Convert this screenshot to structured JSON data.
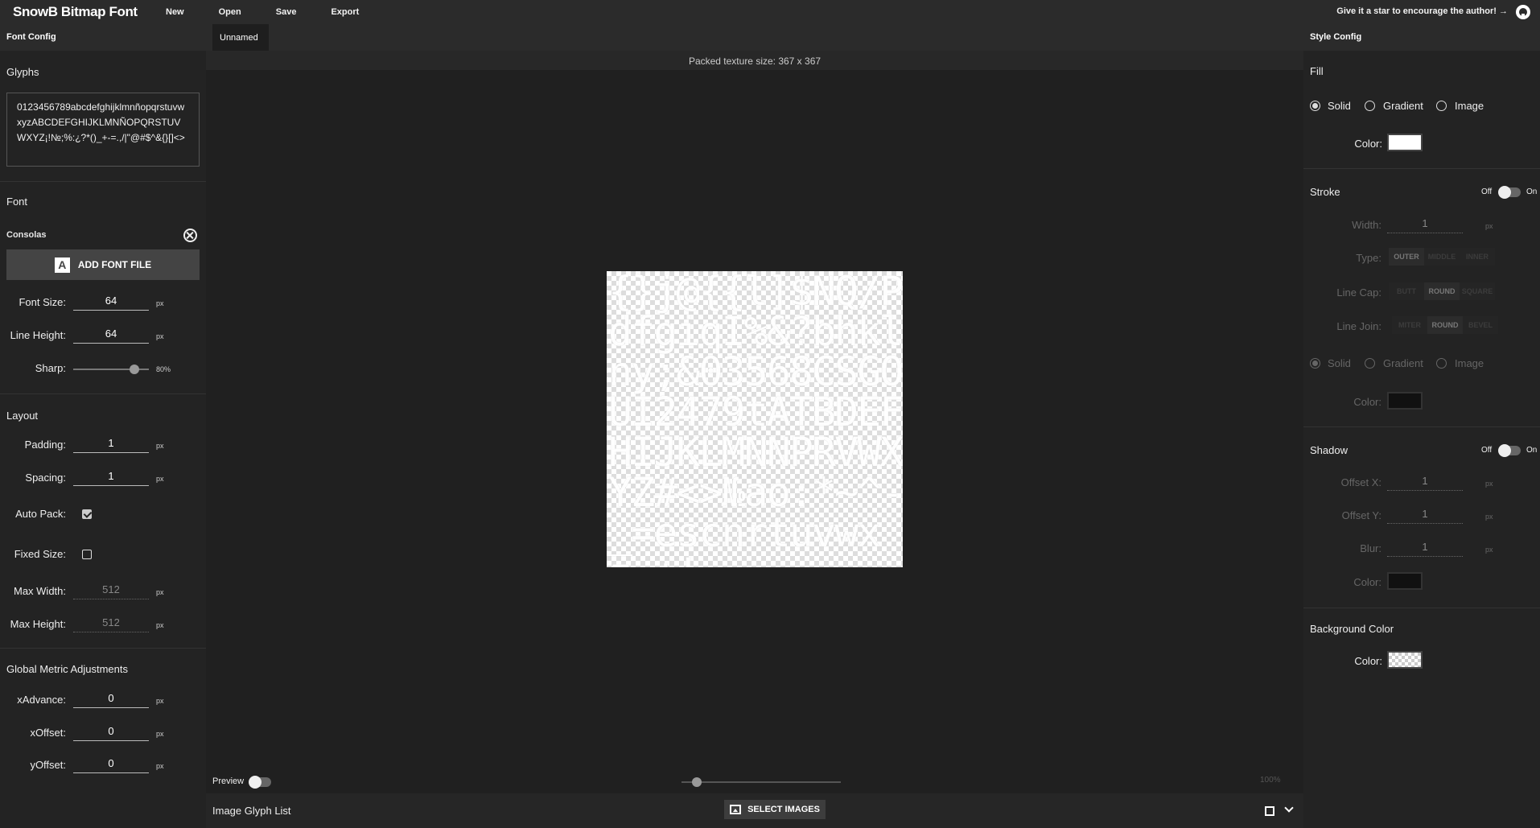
{
  "app": {
    "title": "SnowB Bitmap Font",
    "menu": [
      "New",
      "Open",
      "Save",
      "Export"
    ],
    "star_message": "Give it a star to encourage the author! →"
  },
  "left_panel": {
    "header": "Font Config",
    "glyphs": {
      "title": "Glyphs",
      "text": "0123456789abcdefghijklmnñopqrstuvwxyzABCDEFGHIJKLMNÑOPQRSTUVWXYZ¡!№;%:¿?*()_+-=.,/|\"@#$^&{}[]<>"
    },
    "font": {
      "title": "Font",
      "font_name": "Consolas",
      "add_button": "ADD FONT FILE",
      "font_size": {
        "label": "Font Size:",
        "value": "64",
        "unit": "px"
      },
      "line_height": {
        "label": "Line Height:",
        "value": "64",
        "unit": "px"
      },
      "sharp": {
        "label": "Sharp:",
        "value": "80%",
        "level": 0.8
      }
    },
    "layout": {
      "title": "Layout",
      "padding": {
        "label": "Padding:",
        "value": "1",
        "unit": "px"
      },
      "spacing": {
        "label": "Spacing:",
        "value": "1",
        "unit": "px"
      },
      "auto_pack": {
        "label": "Auto Pack:",
        "checked": true
      },
      "fixed_size": {
        "label": "Fixed Size:",
        "checked": false
      },
      "max_width": {
        "label": "Max Width:",
        "value": "512",
        "unit": "px"
      },
      "max_height": {
        "label": "Max Height:",
        "value": "512",
        "unit": "px"
      }
    },
    "metrics": {
      "title": "Global Metric Adjustments",
      "x_advance": {
        "label": "xAdvance:",
        "value": "0",
        "unit": "px"
      },
      "x_offset": {
        "label": "xOffset:",
        "value": "0",
        "unit": "px"
      },
      "y_offset": {
        "label": "yOffset:",
        "value": "0",
        "unit": "px"
      }
    }
  },
  "center": {
    "tab": "Unnamed",
    "packed_info": "Packed texture size: 367 x 367",
    "texture_glyphs": "{}j@{{l]$NQ/PdfgiqI%&?bhklny;&03568CSGOUI2479tATBDEFHIJKLMNNPRVWXYZ#<>№ao:*~^-_=escnrtuvwxz.+!",
    "preview_label": "Preview",
    "preview_on": false,
    "zoom": "100%",
    "image_glyph_list": "Image Glyph List",
    "select_images": "SELECT IMAGES"
  },
  "right_panel": {
    "header": "Style Config",
    "fill": {
      "title": "Fill",
      "options": [
        "Solid",
        "Gradient",
        "Image"
      ],
      "selected": "Solid",
      "color_label": "Color:",
      "color": "#ffffff"
    },
    "stroke": {
      "title": "Stroke",
      "off_label": "Off",
      "on_label": "On",
      "enabled": false,
      "width": {
        "label": "Width:",
        "value": "1",
        "unit": "px"
      },
      "type": {
        "label": "Type:",
        "options": [
          "OUTER",
          "MIDDLE",
          "INNER"
        ],
        "selected": "OUTER"
      },
      "line_cap": {
        "label": "Line Cap:",
        "options": [
          "BUTT",
          "ROUND",
          "SQUARE"
        ],
        "selected": "ROUND"
      },
      "line_join": {
        "label": "Line Join:",
        "options": [
          "MITER",
          "ROUND",
          "BEVEL"
        ],
        "selected": "ROUND"
      },
      "fill_options": [
        "Solid",
        "Gradient",
        "Image"
      ],
      "color_label": "Color:",
      "color": "#111111"
    },
    "shadow": {
      "title": "Shadow",
      "off_label": "Off",
      "on_label": "On",
      "enabled": false,
      "offset_x": {
        "label": "Offset X:",
        "value": "1",
        "unit": "px"
      },
      "offset_y": {
        "label": "Offset Y:",
        "value": "1",
        "unit": "px"
      },
      "blur": {
        "label": "Blur:",
        "value": "1",
        "unit": "px"
      },
      "color_label": "Color:",
      "color": "#111111"
    },
    "background": {
      "title": "Background Color",
      "color_label": "Color:"
    }
  }
}
